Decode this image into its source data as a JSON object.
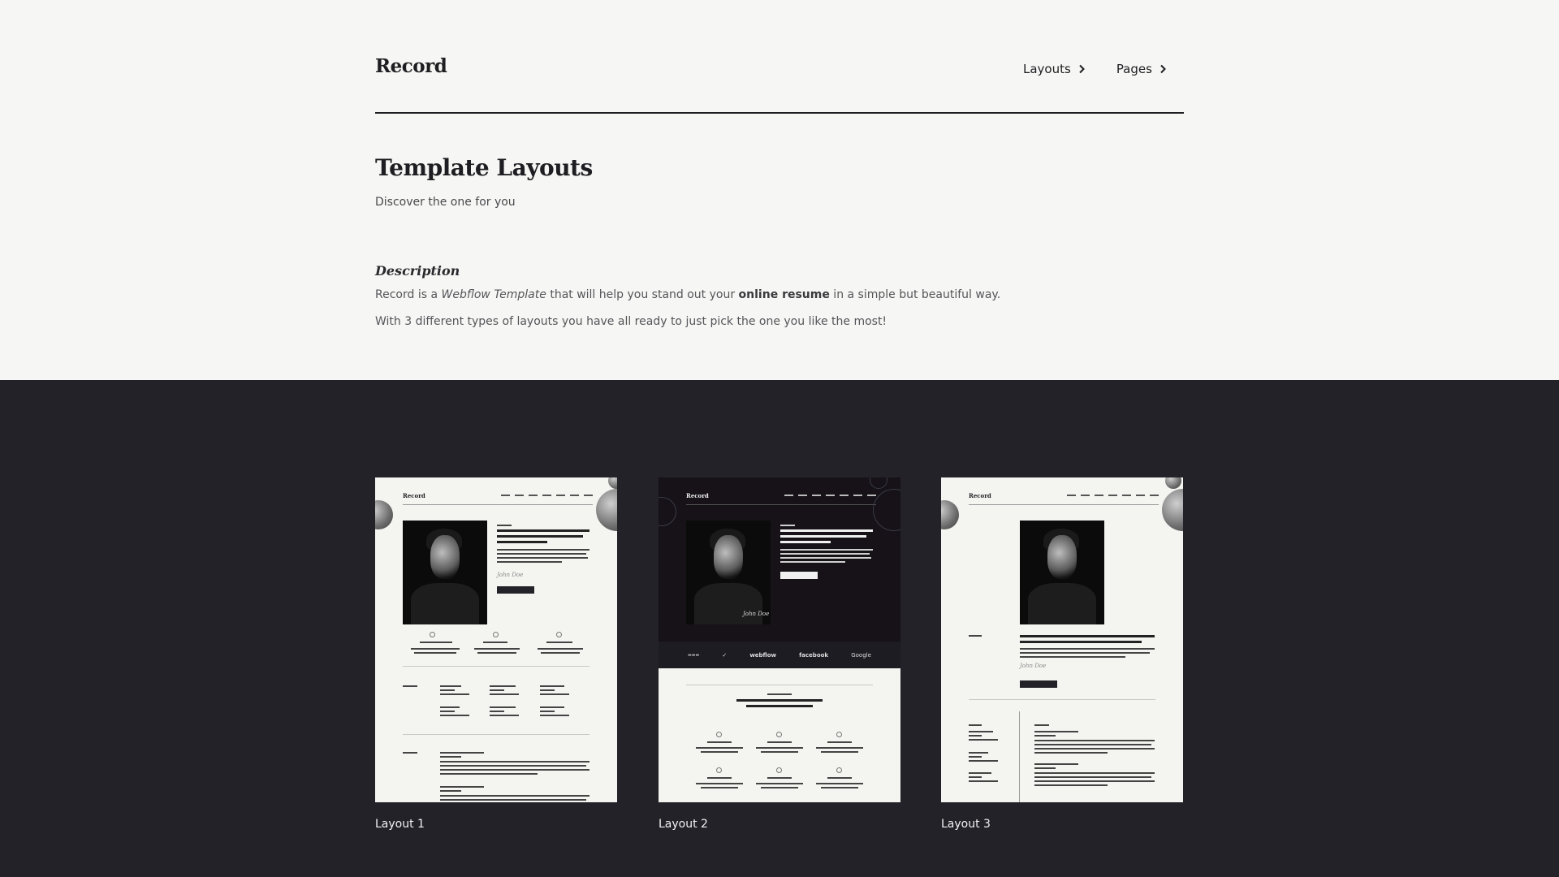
{
  "header": {
    "brand": "Record",
    "nav": [
      {
        "label": "Layouts"
      },
      {
        "label": "Pages"
      }
    ]
  },
  "intro": {
    "title": "Template Layouts",
    "subtitle": "Discover the one for you"
  },
  "description": {
    "heading": "Description",
    "line1": {
      "pre": "Record is a ",
      "em": "Webflow Template",
      "mid": " that will help you stand out your ",
      "strong": "online resume",
      "post": " in a simple but beautiful way."
    },
    "line2": "With 3 different types of layouts you have all ready to just pick the one you like the most!"
  },
  "layouts": [
    {
      "caption": "Layout 1"
    },
    {
      "caption": "Layout 2"
    },
    {
      "caption": "Layout 3"
    }
  ],
  "thumbnails": {
    "logo": "Record",
    "strip_brands": [
      "webflow",
      "facebook",
      "Google"
    ]
  }
}
